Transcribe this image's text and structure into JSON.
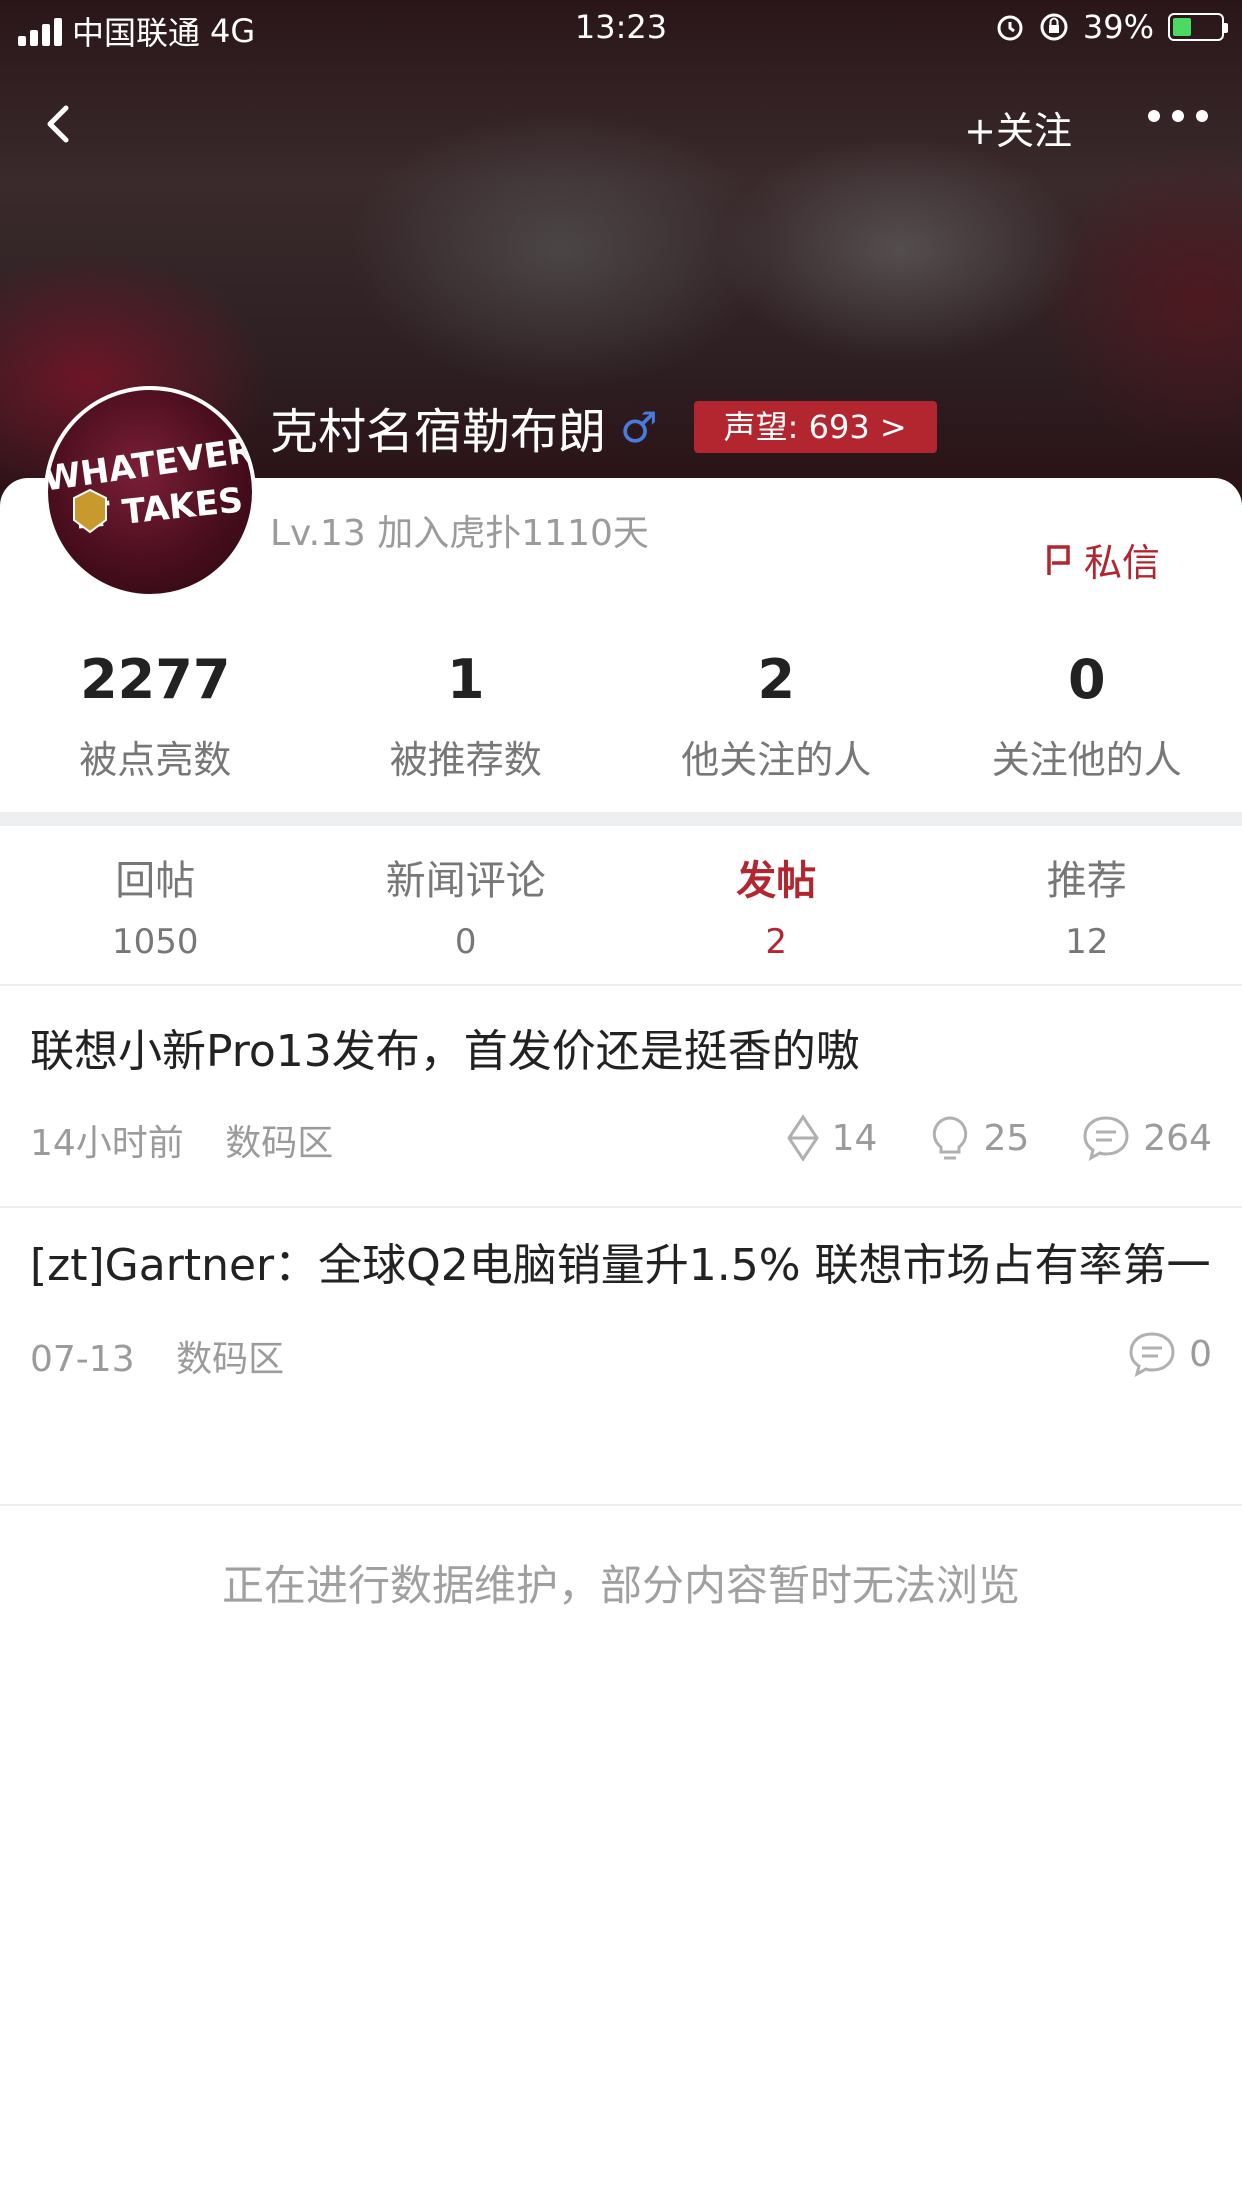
{
  "status_bar": {
    "carrier": "中国联通",
    "network": "4G",
    "time": "13:23",
    "battery": "39%"
  },
  "nav": {
    "follow_label": "+关注"
  },
  "profile": {
    "name": "克村名宿勒布朗",
    "gender_symbol": "♂",
    "reputation": "声望: 693 >",
    "level_info": "Lv.13 加入虎扑1110天",
    "message_label": "私信",
    "avatar_text": "WHATEVER IT TAKES"
  },
  "stats": [
    {
      "value": "2277",
      "label": "被点亮数"
    },
    {
      "value": "1",
      "label": "被推荐数"
    },
    {
      "value": "2",
      "label": "他关注的人"
    },
    {
      "value": "0",
      "label": "关注他的人"
    }
  ],
  "tabs": [
    {
      "label": "回帖",
      "count": "1050"
    },
    {
      "label": "新闻评论",
      "count": "0"
    },
    {
      "label": "发帖",
      "count": "2"
    },
    {
      "label": "推荐",
      "count": "12"
    }
  ],
  "posts": [
    {
      "title": "联想小新Pro13发布，首发价还是挺香的嗷",
      "time": "14小时前",
      "section": "数码区",
      "recommends": "14",
      "lights": "25",
      "replies": "264"
    },
    {
      "title": "[zt]Gartner：全球Q2电脑销量升1.5% 联想市场占有率第一",
      "time": "07-13",
      "section": "数码区",
      "replies": "0"
    }
  ],
  "notice": "正在进行数据维护，部分内容暂时无法浏览",
  "colors": {
    "accent": "#b3252f",
    "gender": "#4a7ce0",
    "battery_fill": "#4cd964"
  }
}
